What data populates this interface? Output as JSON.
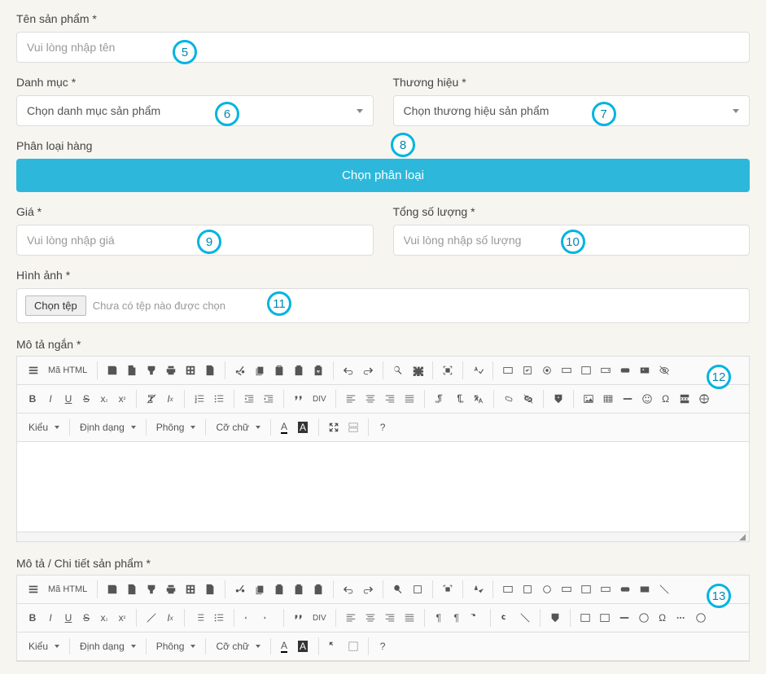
{
  "labels": {
    "product_name": "Tên sản phẩm *",
    "category": "Danh mục *",
    "brand": "Thương hiệu *",
    "classification": "Phân loại hàng",
    "price": "Giá *",
    "quantity": "Tổng số lượng *",
    "image": "Hình ảnh *",
    "short_desc": "Mô tả ngắn *",
    "full_desc": "Mô tả / Chi tiết sản phẩm *"
  },
  "placeholders": {
    "product_name": "Vui lòng nhập tên",
    "category": "Chọn danh mục sản phẩm",
    "brand": "Chọn thương hiệu sản phẩm",
    "price": "Vui lòng nhập giá",
    "quantity": "Vui lòng nhập số lượng"
  },
  "buttons": {
    "classification": "Chọn phân loại",
    "file_choose": "Chọn tệp",
    "file_none": "Chưa có tệp nào được chọn"
  },
  "editor": {
    "source": "Mã HTML",
    "style": "Kiểu",
    "format": "Định dạng",
    "font": "Phông",
    "size": "Cỡ chữ"
  },
  "badges": {
    "b5": "5",
    "b6": "6",
    "b7": "7",
    "b8": "8",
    "b9": "9",
    "b10": "10",
    "b11": "11",
    "b12": "12",
    "b13": "13"
  }
}
